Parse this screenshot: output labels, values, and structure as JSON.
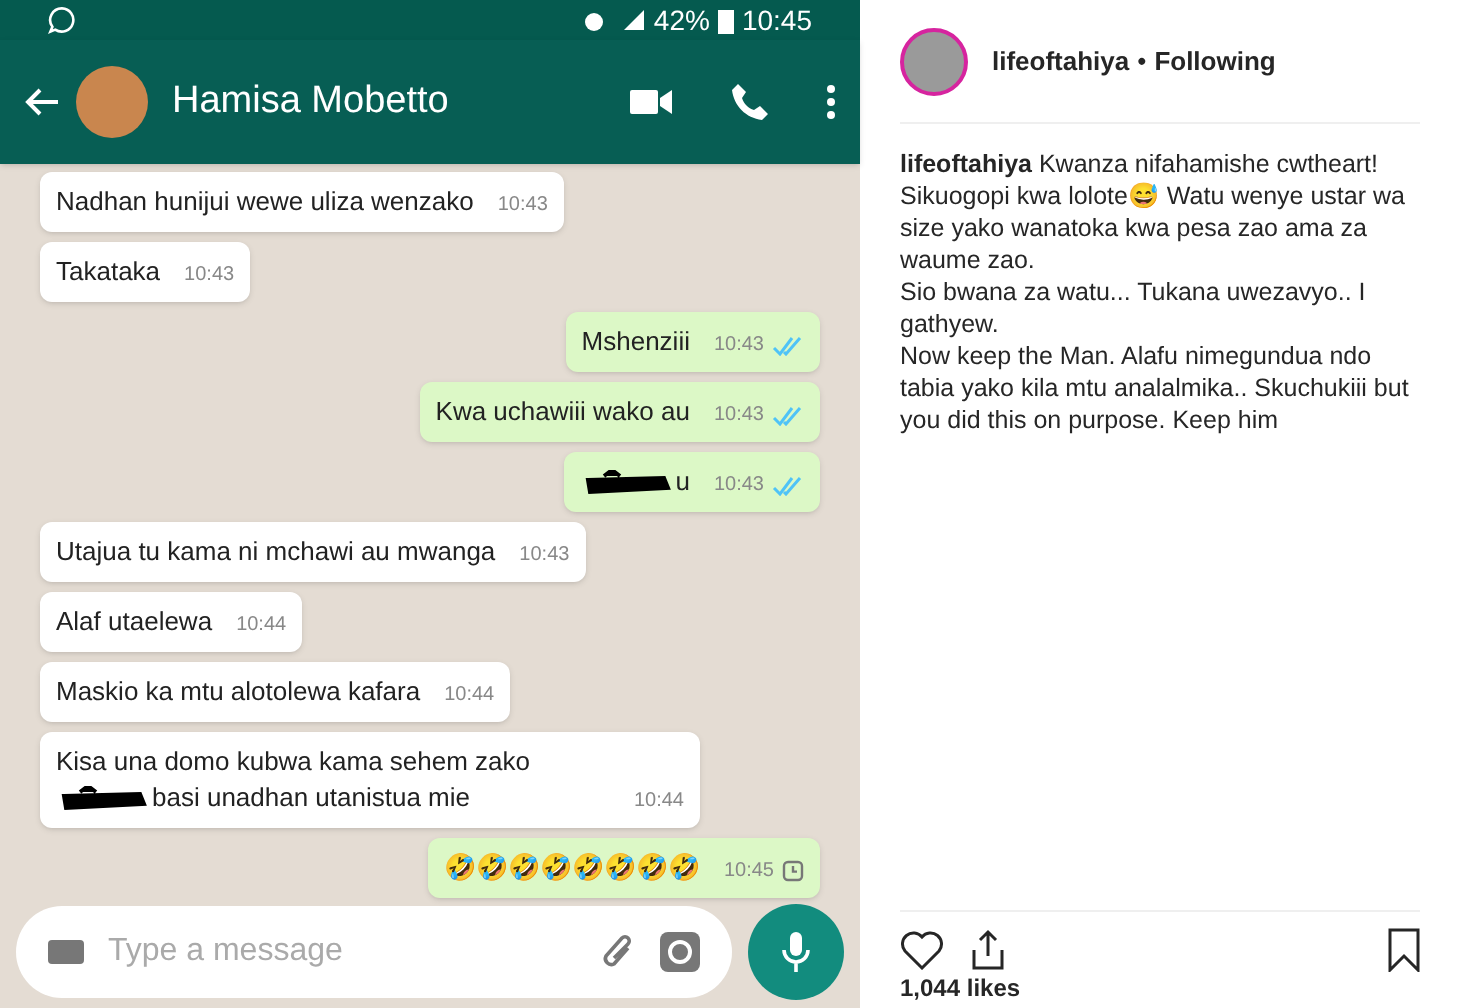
{
  "screenshot": {
    "status_bar": {
      "battery": "42%",
      "time": "10:45"
    },
    "chat_header": {
      "contact_name": "Hamisa Mobetto"
    },
    "messages": [
      {
        "outgoing": false,
        "parts": [
          {
            "kind": "text",
            "text": "Nadhan hunijui wewe uliza wenzako"
          }
        ],
        "time": "10:43"
      },
      {
        "outgoing": false,
        "parts": [
          {
            "kind": "text",
            "text": "Takataka"
          }
        ],
        "time": "10:43"
      },
      {
        "outgoing": true,
        "parts": [
          {
            "kind": "text",
            "text": "Mshenziii"
          }
        ],
        "time": "10:43",
        "pending": false
      },
      {
        "outgoing": true,
        "parts": [
          {
            "kind": "text",
            "text": "Kwa uchawiii wako au"
          }
        ],
        "time": "10:43",
        "pending": false
      },
      {
        "outgoing": true,
        "parts": [
          {
            "kind": "redacted"
          },
          {
            "kind": "text",
            "text": "u"
          }
        ],
        "time": "10:43",
        "pending": false
      },
      {
        "outgoing": false,
        "parts": [
          {
            "kind": "text",
            "text": "Utajua tu kama ni mchawi au mwanga"
          }
        ],
        "time": "10:43"
      },
      {
        "outgoing": false,
        "parts": [
          {
            "kind": "text",
            "text": "Alaf utaelewa"
          }
        ],
        "time": "10:44"
      },
      {
        "outgoing": false,
        "parts": [
          {
            "kind": "text",
            "text": "Maskio ka mtu alotolewa kafara"
          }
        ],
        "time": "10:44"
      },
      {
        "outgoing": false,
        "parts": [
          {
            "kind": "text",
            "text": "Kisa una domo kubwa kama sehem zako"
          },
          {
            "kind": "redacted"
          },
          {
            "kind": "text",
            "text": "basi unadhan utanistua mie"
          }
        ],
        "time": "10:44"
      },
      {
        "outgoing": true,
        "parts": [
          {
            "kind": "text",
            "text": "🤣🤣🤣🤣🤣🤣🤣🤣"
          }
        ],
        "time": "10:45",
        "pending": true
      }
    ],
    "input": {
      "placeholder": "Type a message"
    }
  },
  "post": {
    "username": "lifeoftahiya",
    "separator": "•",
    "follow_status": "Following",
    "caption": "**lifeoftahiya** Kwanza nifahamishe cwtheart! Sikuogopi kwa lolote😅 Watu wenye ustar wa size yako wanatoka kwa pesa zao ama za waume zao.\nSio bwana za watu... Tukana uwezavyo.. I gathyew.\nNow keep the Man. Alafu nimegundua ndo tabia yako kila mtu analalmika.. Skuchukiii but you did this on purpose. Keep him",
    "likes": "1,044 likes"
  }
}
